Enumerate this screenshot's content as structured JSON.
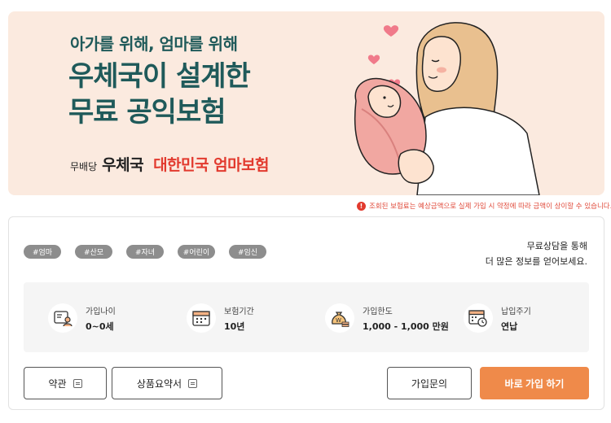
{
  "banner": {
    "subtitle": "아가를 위해, 엄마를 위해",
    "title_line1": "우체국이 설계한",
    "title_line2": "무료 공익보험",
    "brand_prefix": "무배당",
    "brand_name": "우체국",
    "brand_highlight": "대한민국 엄마보험",
    "colors": {
      "background": "#fbeadf",
      "title": "#1f5a5a",
      "highlight": "#e23a2e"
    }
  },
  "notice": {
    "icon": "exclamation-icon",
    "text": "조회된 보험료는 예상금액으로 실제 가입 시 약정에 따라 금액이 상이할 수 있습니다."
  },
  "tags": [
    "#엄마",
    "#산모",
    "#자녀",
    "#어린이",
    "#임신"
  ],
  "consult": {
    "line1": "무료상담을 통해",
    "line2": "더 많은 정보를 얻어보세요."
  },
  "info": {
    "age": {
      "label": "가입나이",
      "value": "0~0세",
      "icon": "person-card-icon"
    },
    "period": {
      "label": "보험기간",
      "value": "10년",
      "icon": "calendar-icon"
    },
    "limit": {
      "label": "가입한도",
      "value": "1,000 - 1,000 만원",
      "icon": "money-bag-icon"
    },
    "cycle": {
      "label": "납입주기",
      "value": "연납",
      "icon": "calendar-clock-icon"
    }
  },
  "buttons": {
    "terms": "약관",
    "summary": "상품요약서",
    "inquiry": "가입문의",
    "apply": "바로 가입 하기"
  },
  "accent_color": "#ef8a4a"
}
